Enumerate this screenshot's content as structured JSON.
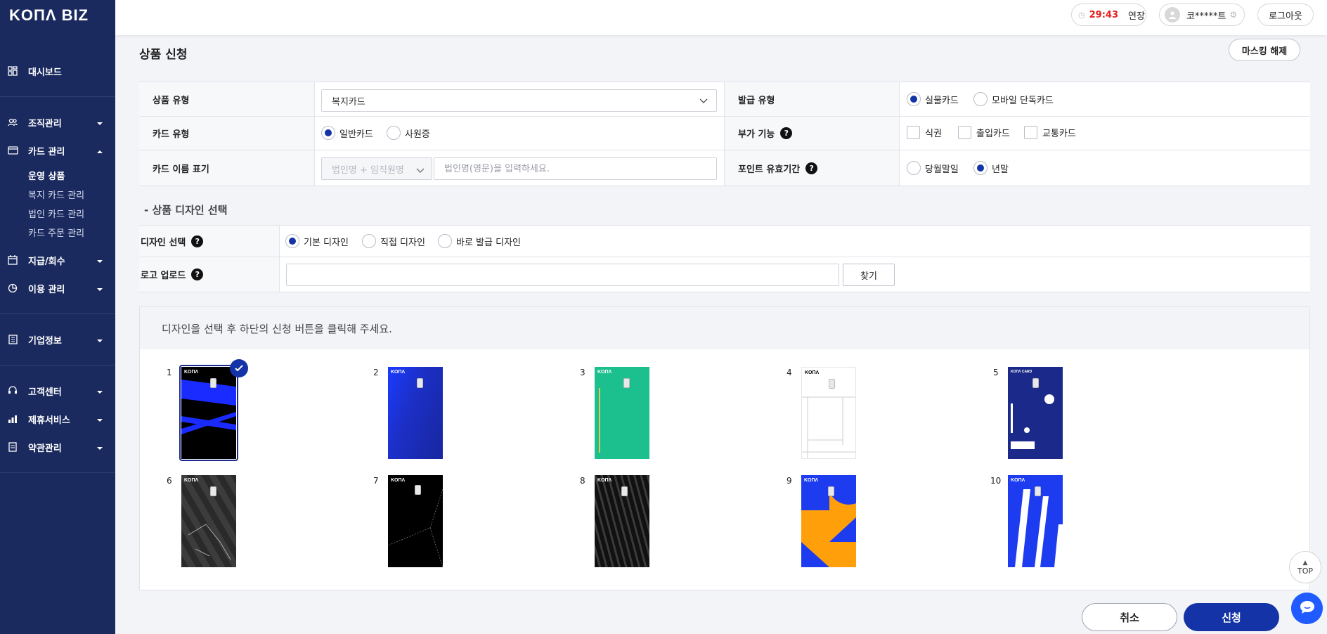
{
  "brand": {
    "logo": "KOΠΛ BIZ"
  },
  "sidebar": {
    "dashboard": "대시보드",
    "org": "조직관리",
    "card_mgmt": "카드 관리",
    "sub": {
      "operating": "운영 상품",
      "welfare": "복지 카드 관리",
      "corporate": "법인 카드 관리",
      "order": "카드 주문 관리"
    },
    "payment": "지급/회수",
    "usage": "이용 관리",
    "company": "기업정보",
    "support": "고객센터",
    "partner": "제휴서비스",
    "terms": "약관관리"
  },
  "topbar": {
    "timer": "29:43",
    "extend": "연장",
    "user": "코*****트",
    "logout": "로그아웃"
  },
  "page": {
    "title": "상품 신청",
    "unmask": "마스킹 해제"
  },
  "form": {
    "product_type_label": "상품 유형",
    "product_type_value": "복지카드",
    "issue_type_label": "발급 유형",
    "issue_opt1": "실물카드",
    "issue_opt2": "모바일 단독카드",
    "card_type_label": "카드 유형",
    "card_opt1": "일반카드",
    "card_opt2": "사원증",
    "extra_label": "부가 기능",
    "extra_opt1": "식권",
    "extra_opt2": "출입카드",
    "extra_opt3": "교통카드",
    "name_label": "카드 이름 표기",
    "name_select": "법인명 + 임직원명",
    "name_placeholder": "법인명(영문)을 입력하세요.",
    "point_label": "포인트 유효기간",
    "point_opt1": "당월말일",
    "point_opt2": "년말"
  },
  "design": {
    "section_title": "- 상품 디자인 선택",
    "select_label": "디자인 선택",
    "opt1": "기본 디자인",
    "opt2": "직접 디자인",
    "opt3": "바로 발급 디자인",
    "logo_label": "로고 업로드",
    "find": "찾기",
    "instruction": "디자인을 선택 후 하단의 신청 버튼을 클릭해 주세요.",
    "cards": [
      {
        "num": "1",
        "brand": "KOΠΛ"
      },
      {
        "num": "2",
        "brand": "KOΠΛ"
      },
      {
        "num": "3",
        "brand": "KOΠΛ"
      },
      {
        "num": "4",
        "brand": "KOΠΛ"
      },
      {
        "num": "5",
        "brand": "KOΠΛ CARD"
      },
      {
        "num": "6",
        "brand": "KOΠΛ"
      },
      {
        "num": "7",
        "brand": "KOΠΛ"
      },
      {
        "num": "8",
        "brand": "KOΠΛ"
      },
      {
        "num": "9",
        "brand": "KOΠΛ"
      },
      {
        "num": "10",
        "brand": "KOΠΛ"
      }
    ]
  },
  "actions": {
    "cancel": "취소",
    "submit": "신청",
    "top": "TOP"
  },
  "colors": {
    "sidebar": "#1a2a5e",
    "accent": "#1433a6",
    "timer": "#e02020"
  }
}
